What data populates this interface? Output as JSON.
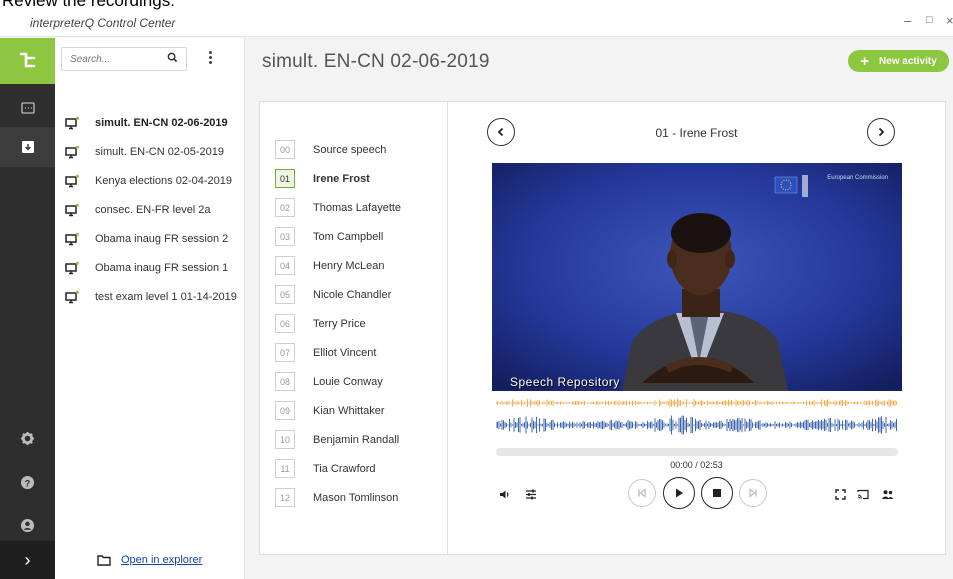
{
  "caption": "Review the recordings:",
  "window": {
    "title": "interpreterQ Control Center",
    "controls": [
      "–",
      "□",
      "×"
    ]
  },
  "rail": {
    "items": [
      "recordings-icon",
      "download-icon"
    ],
    "bottom": [
      "settings-icon",
      "help-icon",
      "user-icon"
    ],
    "expand_label": "›"
  },
  "search": {
    "placeholder": "Search..."
  },
  "activities": [
    {
      "label": "simult. EN-CN 02-06-2019",
      "selected": true
    },
    {
      "label": "simult. EN-CN 02-05-2019"
    },
    {
      "label": "Kenya elections 02-04-2019"
    },
    {
      "label": "consec. EN-FR level 2a"
    },
    {
      "label": "Obama inaug FR session 2"
    },
    {
      "label": "Obama inaug FR session 1"
    },
    {
      "label": "test exam level 1 01-14-2019"
    }
  ],
  "explorer_link": "Open in explorer",
  "page_title": "simult. EN-CN 02-06-2019",
  "new_activity": {
    "label": "New activity"
  },
  "participants": [
    {
      "num": "00",
      "name": "Source speech"
    },
    {
      "num": "01",
      "name": "Irene Frost",
      "selected": true
    },
    {
      "num": "02",
      "name": "Thomas Lafayette"
    },
    {
      "num": "03",
      "name": "Tom Campbell"
    },
    {
      "num": "04",
      "name": "Henry McLean"
    },
    {
      "num": "05",
      "name": "Nicole Chandler"
    },
    {
      "num": "06",
      "name": "Terry Price"
    },
    {
      "num": "07",
      "name": "Elliot Vincent"
    },
    {
      "num": "08",
      "name": "Louie Conway"
    },
    {
      "num": "09",
      "name": "Kian Whittaker"
    },
    {
      "num": "10",
      "name": "Benjamin Randall"
    },
    {
      "num": "11",
      "name": "Tia Crawford"
    },
    {
      "num": "12",
      "name": "Mason Tomlinson"
    }
  ],
  "player": {
    "track_title": "01 - Irene Frost",
    "watermark": "Speech Repository",
    "logo_text": "European Commission",
    "time": "00:00 / 02:53",
    "progress": 0
  },
  "colors": {
    "accent": "#8dc63f",
    "wave_source": "#f0a53c",
    "wave_interp": "#2b56a8",
    "rail": "#2e2e2e"
  }
}
